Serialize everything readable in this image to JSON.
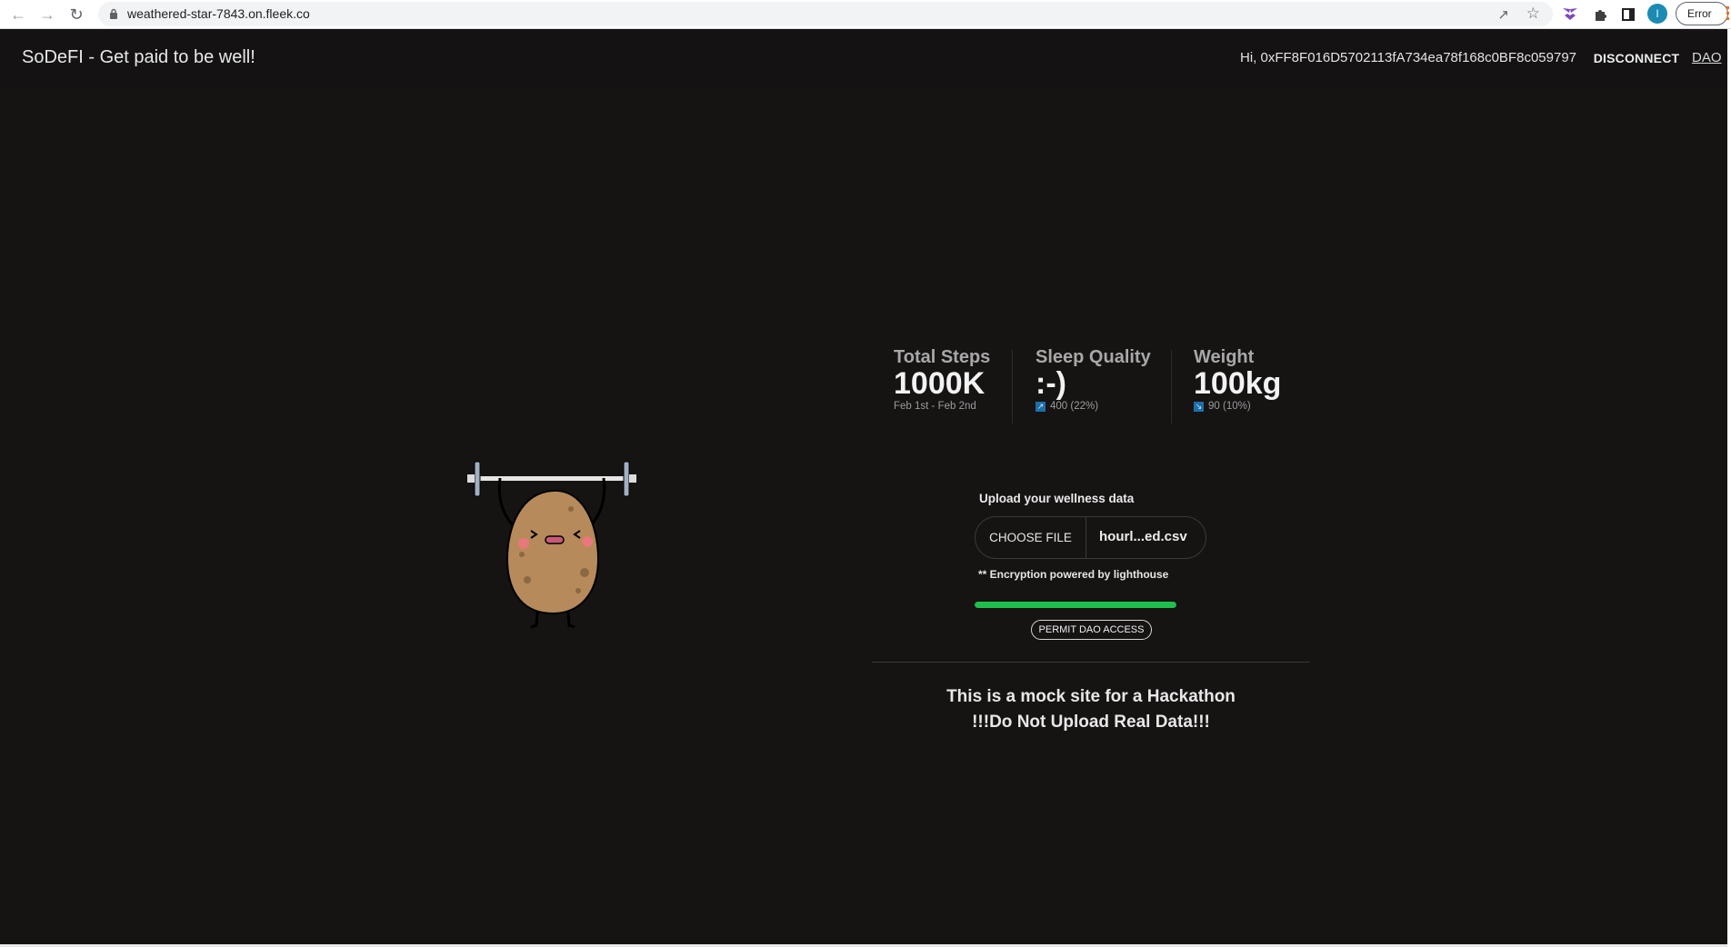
{
  "browser": {
    "url": "weathered-star-7843.on.fleek.co",
    "profile_initial": "I",
    "error_label": "Error"
  },
  "header": {
    "brand": "SoDeFI - Get paid to be well!",
    "greeting": "Hi, 0xFF8F016D5702113fA734ea78f168c0BF8c059797",
    "disconnect_label": "DISCONNECT",
    "dao_link": "DAO"
  },
  "stats": [
    {
      "title": "Total Steps",
      "value": "1000K",
      "desc": "Feb 1st - Feb 2nd",
      "trend": null
    },
    {
      "title": "Sleep Quality",
      "value": ":-)",
      "desc": "400 (22%)",
      "trend": "up"
    },
    {
      "title": "Weight",
      "value": "100kg",
      "desc": "90 (10%)",
      "trend": "down"
    }
  ],
  "upload": {
    "label": "Upload your wellness data",
    "choose_file_label": "CHOOSE FILE",
    "file_name": "hourl...ed.csv",
    "encryption_note": "** Encryption powered by lighthouse",
    "progress": 1.0,
    "permit_label": "PERMIT DAO ACCESS"
  },
  "notice": {
    "line1": "This is a mock site for a Hackathon",
    "line2": "!!!Do Not Upload Real Data!!!"
  },
  "colors": {
    "background": "#161313",
    "progress": "#1fbf4d",
    "trend_icon": "#1e6fa8"
  }
}
